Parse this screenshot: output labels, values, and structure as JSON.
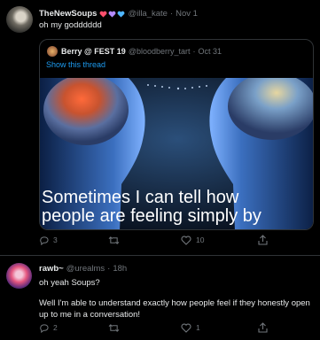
{
  "tweets": [
    {
      "display_name": "TheNewSoups",
      "handle": "@illa_kate",
      "separator": "·",
      "date": "Nov 1",
      "text": "oh my godddddd",
      "hearts": [
        "#ff4f6d",
        "#b48bff",
        "#4fb6ff"
      ],
      "quote": {
        "display_name": "Berry @ FEST 19",
        "handle": "@bloodberry_tart",
        "separator": "·",
        "date": "Oct 31",
        "show_thread": "Show this thread",
        "caption_line1": "Sometimes I can tell how",
        "caption_line2": "people are feeling simply by"
      },
      "actions": {
        "reply_count": "3",
        "retweet_count": "",
        "like_count": "10"
      }
    },
    {
      "display_name": "rawb~",
      "handle": "@urealms",
      "separator": "·",
      "date": "18h",
      "text1": "oh yeah Soups?",
      "text2": "Well I'm able to understand exactly how people feel if they honestly open up to me in a conversation!",
      "actions": {
        "reply_count": "2",
        "retweet_count": "",
        "like_count": "1"
      }
    }
  ],
  "icons": {
    "reply": "reply-icon",
    "retweet": "retweet-icon",
    "like": "heart-icon",
    "share": "share-icon"
  },
  "colors": {
    "background": "#000000",
    "text": "#e7e9ea",
    "muted": "#71767b",
    "link": "#1d9bf0",
    "border": "#2f3336"
  }
}
